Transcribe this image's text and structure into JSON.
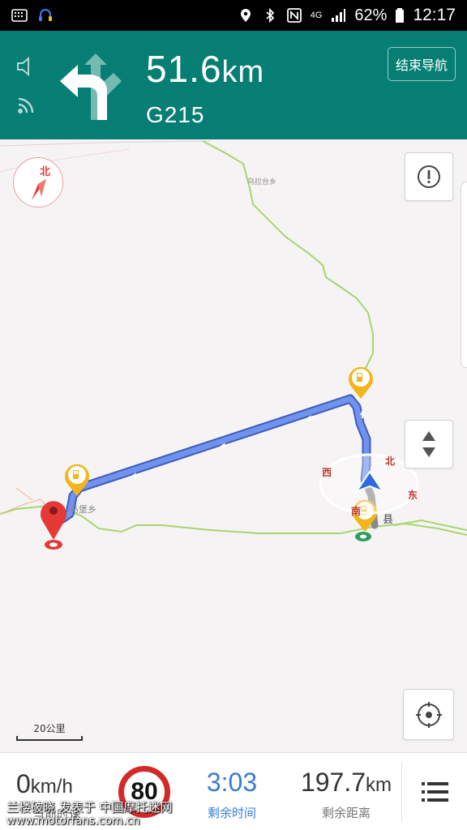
{
  "status_bar": {
    "battery": "62%",
    "time": "12:17",
    "network": "4G",
    "icons": [
      "keyboard-icon",
      "headset-icon",
      "location-icon",
      "bluetooth-icon",
      "nfc-icon",
      "signal-icon",
      "battery-icon"
    ]
  },
  "nav_header": {
    "distance_value": "51.6",
    "distance_unit": "km",
    "road_name": "G215",
    "end_button_label": "结束导航",
    "turn_icon": "turn-left-arrow-icon",
    "colors": {
      "header_bg": "#067e74",
      "text": "#ffffff"
    }
  },
  "map": {
    "compass_label": "北",
    "place_labels": {
      "top_town": "乌拉台乡",
      "left_town": "马堡乡",
      "right_town": "县"
    },
    "direction_ring": {
      "north": "北",
      "east": "东",
      "south": "南",
      "west": "西"
    },
    "scale_label": "20公里",
    "colors": {
      "route": "#5b86e5",
      "route_remaining": "#9a9a9a",
      "road": "#9ad06a",
      "bg": "#f6f3f5",
      "destination": "#e53935"
    }
  },
  "bottom_panel": {
    "speed_value": "0",
    "speed_unit": "km/h",
    "speed_limit": "80",
    "remaining_time_value": "3:03",
    "remaining_time_label": "剩余时间",
    "remaining_distance_value": "197.7",
    "remaining_distance_unit": "km",
    "remaining_distance_label": "剩余距离",
    "current_speed_label": "当前时速"
  },
  "watermark": {
    "line1": "兰楼破晓 发表于 中国摩托迷网",
    "line2": "www.motorfans.com.cn"
  }
}
